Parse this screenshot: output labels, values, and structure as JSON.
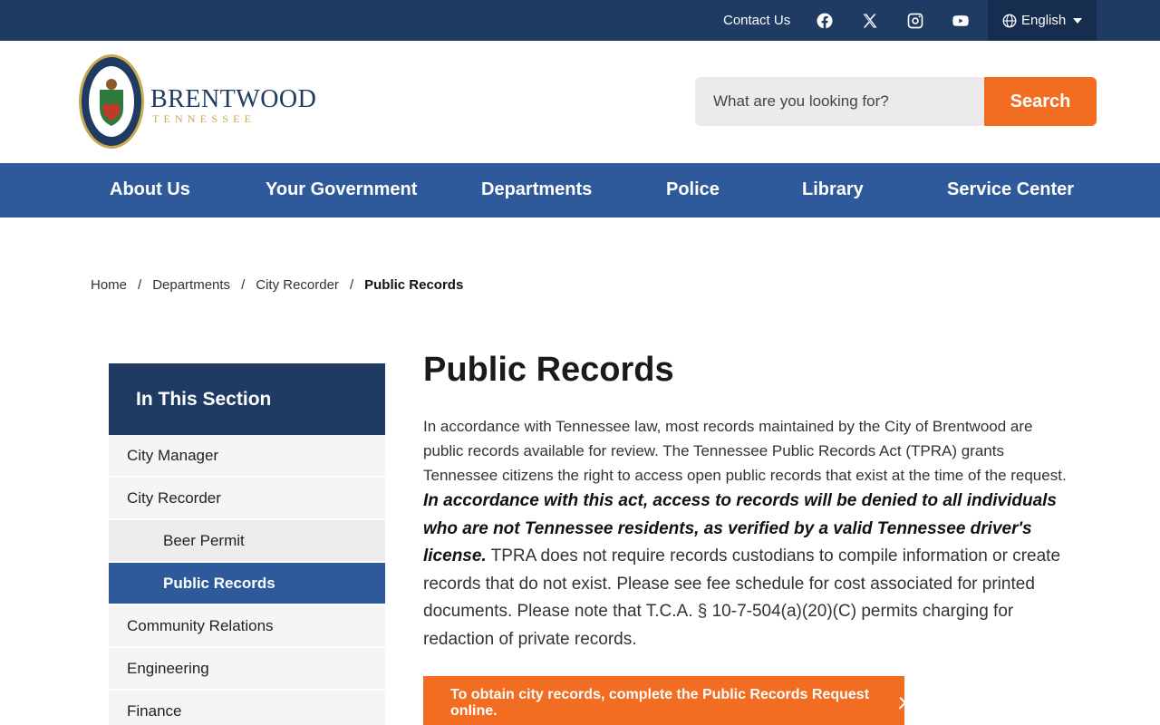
{
  "utility": {
    "contact_label": "Contact Us",
    "social": [
      "facebook-icon",
      "x-twitter-icon",
      "instagram-icon",
      "youtube-icon"
    ],
    "language_label": "English"
  },
  "header": {
    "logo_word": "BRENTWOOD",
    "logo_sub": "TENNESSEE",
    "search_placeholder": "What are you looking for?",
    "search_button": "Search"
  },
  "nav": {
    "items": [
      "About Us",
      "Your Government",
      "Departments",
      "Police",
      "Library",
      "Service Center"
    ]
  },
  "breadcrumb": {
    "items": [
      "Home",
      "Departments",
      "City Recorder"
    ],
    "current": "Public Records"
  },
  "sidebar": {
    "heading": "In This Section",
    "items": [
      "City Manager",
      "City Recorder",
      "Beer Permit",
      "Public Records",
      "Community Relations",
      "Engineering",
      "Finance"
    ]
  },
  "content": {
    "title": "Public Records",
    "para_part1": "In accordance with Tennessee law, most records maintained by the City of Brentwood are public records available for review. The Tennessee Public Records Act (TPRA) grants Tennessee citizens the right to access open public records that exist at the time of the request. ",
    "para_bold": "In accordance with this act, access to records will be denied to all individuals who are not Tennessee residents, as verified by a valid Tennessee driver's license.",
    "para_part2": "  TPRA does not require records custodians to compile information or create records that do not exist. Please see fee schedule for cost associated for printed documents. Please note that T.C.A. § 10-7-504(a)(20)(C) permits charging for redaction of private records.",
    "cta_label": "To obtain city records, complete the Public Records Request online."
  },
  "colors": {
    "navy": "#1f3a63",
    "nav_blue": "#2e5a9b",
    "orange": "#f26d21",
    "gold": "#c9a94d"
  }
}
